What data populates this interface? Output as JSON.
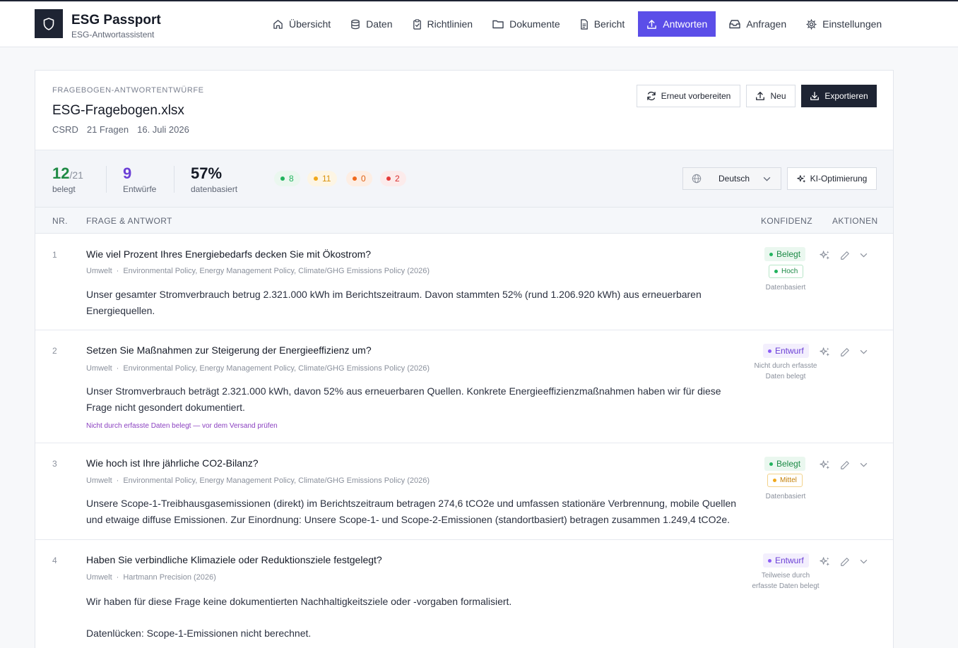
{
  "app": {
    "title": "ESG Passport",
    "subtitle": "ESG-Antwortassistent"
  },
  "nav": [
    {
      "label": "Übersicht",
      "icon": "home-icon",
      "active": false
    },
    {
      "label": "Daten",
      "icon": "database-icon",
      "active": false
    },
    {
      "label": "Richtlinien",
      "icon": "clipboard-icon",
      "active": false
    },
    {
      "label": "Dokumente",
      "icon": "folder-icon",
      "active": false
    },
    {
      "label": "Bericht",
      "icon": "file-icon",
      "active": false
    },
    {
      "label": "Antworten",
      "icon": "upload-icon",
      "active": true
    },
    {
      "label": "Anfragen",
      "icon": "inbox-icon",
      "active": false
    },
    {
      "label": "Einstellungen",
      "icon": "gear-icon",
      "active": false
    }
  ],
  "header": {
    "kicker": "FRAGEBOGEN-ANTWORTENTWÜRFE",
    "file_name": "ESG-Fragebogen.xlsx",
    "framework": "CSRD",
    "question_count": "21 Fragen",
    "date": "16. Juli 2026",
    "btn_prepare": "Erneut vorbereiten",
    "btn_new": "Neu",
    "btn_export": "Exportieren"
  },
  "stats": {
    "covered": "12",
    "covered_total": "/21",
    "covered_label": "belegt",
    "drafts": "9",
    "drafts_label": "Entwürfe",
    "data_based": "57%",
    "data_based_label": "datenbasiert",
    "pills": [
      {
        "value": "8",
        "color": "#22b35e",
        "bg": "#eaf7ef"
      },
      {
        "value": "11",
        "color": "#f0a81c",
        "bg": "#fdf5e4"
      },
      {
        "value": "0",
        "color": "#f06a1c",
        "bg": "#fdeee4"
      },
      {
        "value": "2",
        "color": "#e53b3b",
        "bg": "#fcebeb"
      }
    ],
    "language": "Deutsch",
    "ai_button": "KI-Optimierung"
  },
  "table": {
    "col_nr": "NR.",
    "col_question": "FRAGE & ANTWORT",
    "col_confidence": "KONFIDENZ",
    "col_actions": "AKTIONEN"
  },
  "rows": [
    {
      "nr": "1",
      "question": "Wie viel Prozent Ihres Energiebedarfs decken Sie mit Ökostrom?",
      "category": "Umwelt",
      "sources": "Environmental Policy, Energy Management Policy, Climate/GHG Emissions Policy (2026)",
      "answer": "Unser gesamter Stromverbrauch betrug 2.321.000 kWh im Berichtszeitraum. Davon stammten 52% (rund 1.206.920 kWh) aus erneuerbaren Energiequellen.",
      "status": "Belegt",
      "level": "Hoch",
      "conf_note": "Datenbasiert",
      "note": ""
    },
    {
      "nr": "2",
      "question": "Setzen Sie Maßnahmen zur Steigerung der Energieeffizienz um?",
      "category": "Umwelt",
      "sources": "Environmental Policy, Energy Management Policy, Climate/GHG Emissions Policy (2026)",
      "answer": "Unser Stromverbrauch beträgt 2.321.000 kWh, davon 52% aus erneuerbaren Quellen. Konkrete Energieeffizienzmaßnahmen haben wir für diese Frage nicht gesondert dokumentiert.",
      "status": "Entwurf",
      "level": "",
      "conf_note": "Nicht durch erfasste Daten belegt",
      "note": "Nicht durch erfasste Daten belegt — vor dem Versand prüfen"
    },
    {
      "nr": "3",
      "question": "Wie hoch ist Ihre jährliche CO2-Bilanz?",
      "category": "Umwelt",
      "sources": "Environmental Policy, Energy Management Policy, Climate/GHG Emissions Policy (2026)",
      "answer": "Unsere Scope-1-Treibhausgasemissionen (direkt) im Berichtszeitraum betragen 274,6 tCO2e und umfassen stationäre Verbrennung, mobile Quellen und etwaige diffuse Emissionen. Zur Einordnung: Unsere Scope-1- und Scope-2-Emissionen (standortbasiert) betragen zusammen 1.249,4 tCO2e.",
      "status": "Belegt",
      "level": "Mittel",
      "conf_note": "Datenbasiert",
      "note": ""
    },
    {
      "nr": "4",
      "question": "Haben Sie verbindliche Klimaziele oder Reduktionsziele festgelegt?",
      "category": "Umwelt",
      "sources": "Hartmann Precision (2026)",
      "answer": "Wir haben für diese Frage keine dokumentierten Nachhaltigkeitsziele oder -vorgaben formalisiert.",
      "answer_extra": "Datenlücken: Scope-1-Emissionen nicht berechnet.",
      "status": "Entwurf",
      "level": "",
      "conf_note": "Teilweise durch erfasste Daten belegt",
      "note": ""
    }
  ]
}
